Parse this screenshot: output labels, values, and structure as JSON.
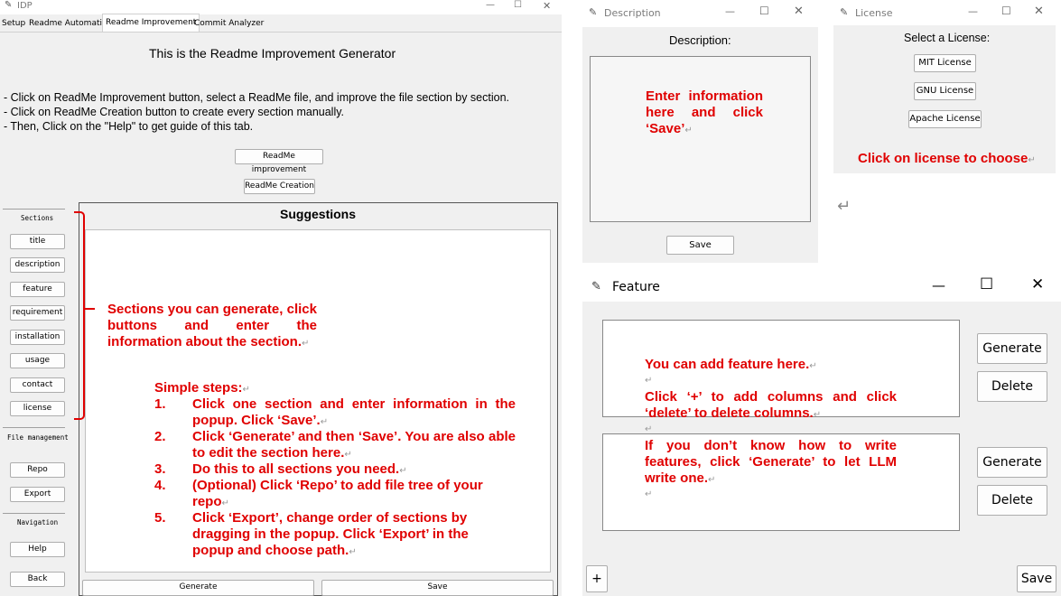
{
  "main": {
    "title": "IDP",
    "tabs": [
      "Setup",
      "Readme Automatic",
      "Readme Improvement",
      "Commit Analyzer"
    ],
    "heading": "This is the Readme Improvement Generator",
    "instructions": [
      "- Click on ReadMe Improvement button, select a ReadMe file, and improve the file section by section.",
      "- Click on ReadMe Creation button to create every section manually.",
      "- Then, Click on the \"Help\" to get guide of this tab."
    ],
    "improve_button": "ReadMe improvement",
    "create_button": "ReadMe Creation",
    "sidebar": {
      "sections_label": "Sections",
      "sections": [
        "title",
        "description",
        "feature",
        "requirement",
        "installation",
        "usage",
        "contact",
        "license"
      ],
      "file_label": "File management",
      "file_buttons": [
        "Repo",
        "Export"
      ],
      "nav_label": "Navigation",
      "nav_buttons": [
        "Help",
        "Back"
      ]
    },
    "suggestions_title": "Suggestions",
    "generate_button": "Generate",
    "save_button": "Save"
  },
  "annotations": {
    "sections_note": "Sections you can generate, click buttons and enter the information about the section.",
    "steps_title": "Simple steps:",
    "steps": [
      {
        "num": "1.",
        "text": "Click one section and enter information in the popup. Click ‘Save’."
      },
      {
        "num": "2.",
        "text": "Click ‘Generate’ and then ‘Save’. You are also able to edit the section here."
      },
      {
        "num": "3.",
        "text": "Do this to all sections you need."
      },
      {
        "num": "4.",
        "text": "(Optional) Click ‘Repo’ to add file tree of your repo"
      },
      {
        "num": "5.",
        "text": "Click ‘Export’, change order of sections by dragging in the popup. Click ‘Export’ in the popup and choose path."
      }
    ],
    "description_note": "Enter information here and click ‘Save’",
    "license_note": "Click on license to choose",
    "feature_note_1": "You can add feature here.",
    "feature_note_2": "Click ‘+’ to add columns and click ‘delete’ to delete columns.",
    "feature_note_3": "If you don’t know how to write features, click ‘Generate’ to let LLM write one.",
    "return_mark": "↵"
  },
  "description_window": {
    "title": "Description",
    "label": "Description:",
    "save_button": "Save"
  },
  "license_window": {
    "title": "License",
    "label": "Select a License:",
    "options": [
      "MIT License",
      "GNU License",
      "Apache License"
    ]
  },
  "feature_window": {
    "title": "Feature",
    "generate_button": "Generate",
    "delete_button": "Delete",
    "add_button": "+",
    "save_button": "Save"
  },
  "icons": {
    "app_icon": "feather-icon",
    "minimize": "minimize-icon",
    "maximize": "maximize-icon",
    "close": "close-icon"
  }
}
